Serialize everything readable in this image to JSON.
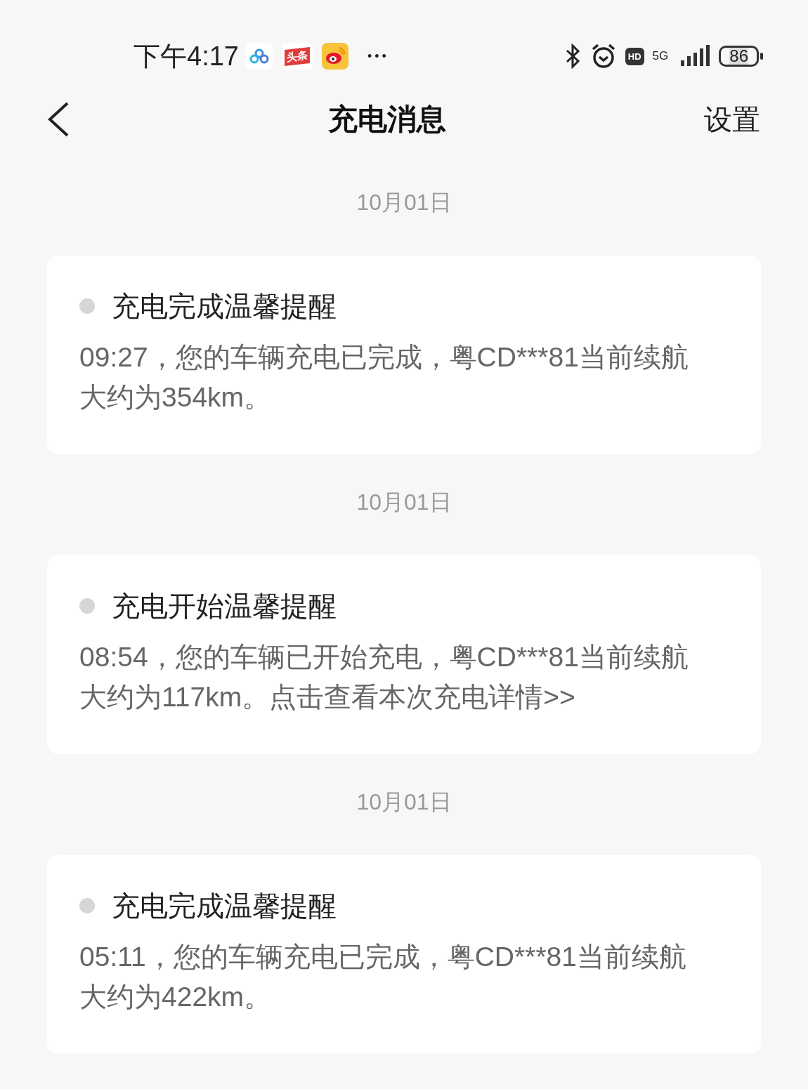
{
  "status_bar": {
    "time": "下午4:17",
    "apps": [
      {
        "kind": "cloud"
      },
      {
        "kind": "news",
        "label": "头条"
      },
      {
        "kind": "weibo"
      }
    ],
    "more": "•••",
    "hd": "HD",
    "network": "5G",
    "battery": "86"
  },
  "header": {
    "title": "充电消息",
    "action": "设置"
  },
  "messages": [
    {
      "date": "10月01日",
      "title": "充电完成温馨提醒",
      "body": "09:27，您的车辆充电已完成，粤CD***81当前续航大约为354km。",
      "unread": false
    },
    {
      "date": "10月01日",
      "title": "充电开始温馨提醒",
      "body": "08:54，您的车辆已开始充电，粤CD***81当前续航大约为117km。点击查看本次充电详情>>",
      "unread": false
    },
    {
      "date": "10月01日",
      "title": "充电完成温馨提醒",
      "body": "05:11，您的车辆充电已完成，粤CD***81当前续航大约为422km。",
      "unread": false
    }
  ]
}
